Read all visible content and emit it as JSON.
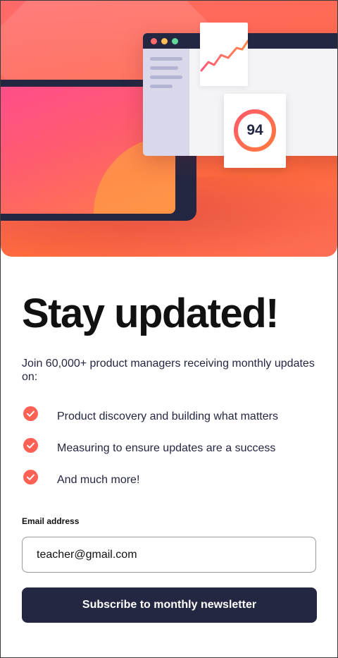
{
  "hero": {
    "score": "94",
    "colors": {
      "navy": "#242742",
      "tomato": "#ff6155",
      "dot_red": "#ff6a6a",
      "dot_yellow": "#ffbd5a",
      "dot_green": "#62d79a"
    }
  },
  "main": {
    "title": "Stay updated!",
    "intro": "Join 60,000+ product managers receiving monthly updates on:",
    "features": [
      {
        "icon": "check-circle-icon",
        "label": "Product discovery and building what matters"
      },
      {
        "icon": "check-circle-icon",
        "label": "Measuring to ensure updates are a success"
      },
      {
        "icon": "check-circle-icon",
        "label": "And much more!"
      }
    ]
  },
  "form": {
    "email_label": "Email address",
    "email_value": "teacher@gmail.com",
    "submit_label": "Subscribe to monthly newsletter"
  }
}
